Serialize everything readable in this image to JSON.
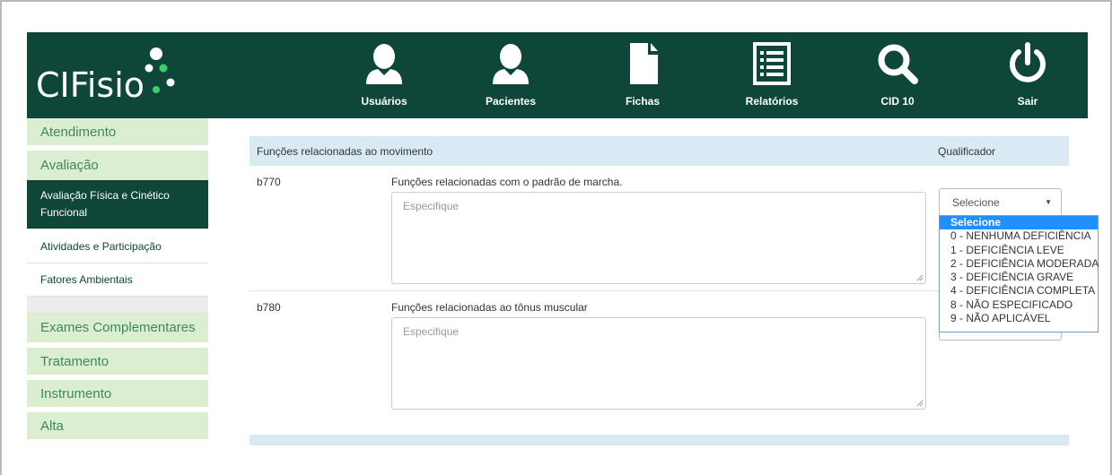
{
  "app": {
    "logo_text": "CIFisio"
  },
  "nav": [
    {
      "label": "Usuários",
      "icon": "user-icon"
    },
    {
      "label": "Pacientes",
      "icon": "patient-icon"
    },
    {
      "label": "Fichas",
      "icon": "document-icon"
    },
    {
      "label": "Relatórios",
      "icon": "report-icon"
    },
    {
      "label": "CID 10",
      "icon": "search-icon"
    },
    {
      "label": "Sair",
      "icon": "power-icon"
    }
  ],
  "sidebar": {
    "items": [
      {
        "label": "Atendimento"
      },
      {
        "label": "Avaliação"
      },
      {
        "label": "Avaliação Física e Cinético Funcional",
        "active": true
      },
      {
        "label": "Atividades e Participação"
      },
      {
        "label": "Fatores Ambientais"
      },
      {
        "label": "Exames Complementares"
      },
      {
        "label": "Tratamento"
      },
      {
        "label": "Instrumento"
      },
      {
        "label": "Alta"
      }
    ]
  },
  "section": {
    "title": "Funções relacionadas ao movimento",
    "qualifier_header": "Qualificador",
    "rows": [
      {
        "code": "b770",
        "description": "Funções relacionadas com o padrão de marcha.",
        "placeholder": "Especifique"
      },
      {
        "code": "b780",
        "description": "Funções relacionadas ao tônus muscular",
        "placeholder": "Especifique"
      }
    ]
  },
  "qualifier_select": {
    "value": "Selecione",
    "options": [
      "Selecione",
      "0 - NENHUMA DEFICIÊNCIA",
      "1 - DEFICIÊNCIA LEVE",
      "2 - DEFICIÊNCIA MODERADA",
      "3 - DEFICIÊNCIA GRAVE",
      "4 - DEFICIÊNCIA COMPLETA",
      "8 - NÃO ESPECIFICADO",
      "9 - NÃO APLICÁVEL"
    ]
  },
  "colors": {
    "header_bg": "#0e4739",
    "sidebar_item_bg": "#dbeecf",
    "sidebar_item_text": "#3c8a5a",
    "section_head_bg": "#d9eaf5",
    "dropdown_highlight": "#1e90ff",
    "logo_dot": "#3ecf6c"
  }
}
